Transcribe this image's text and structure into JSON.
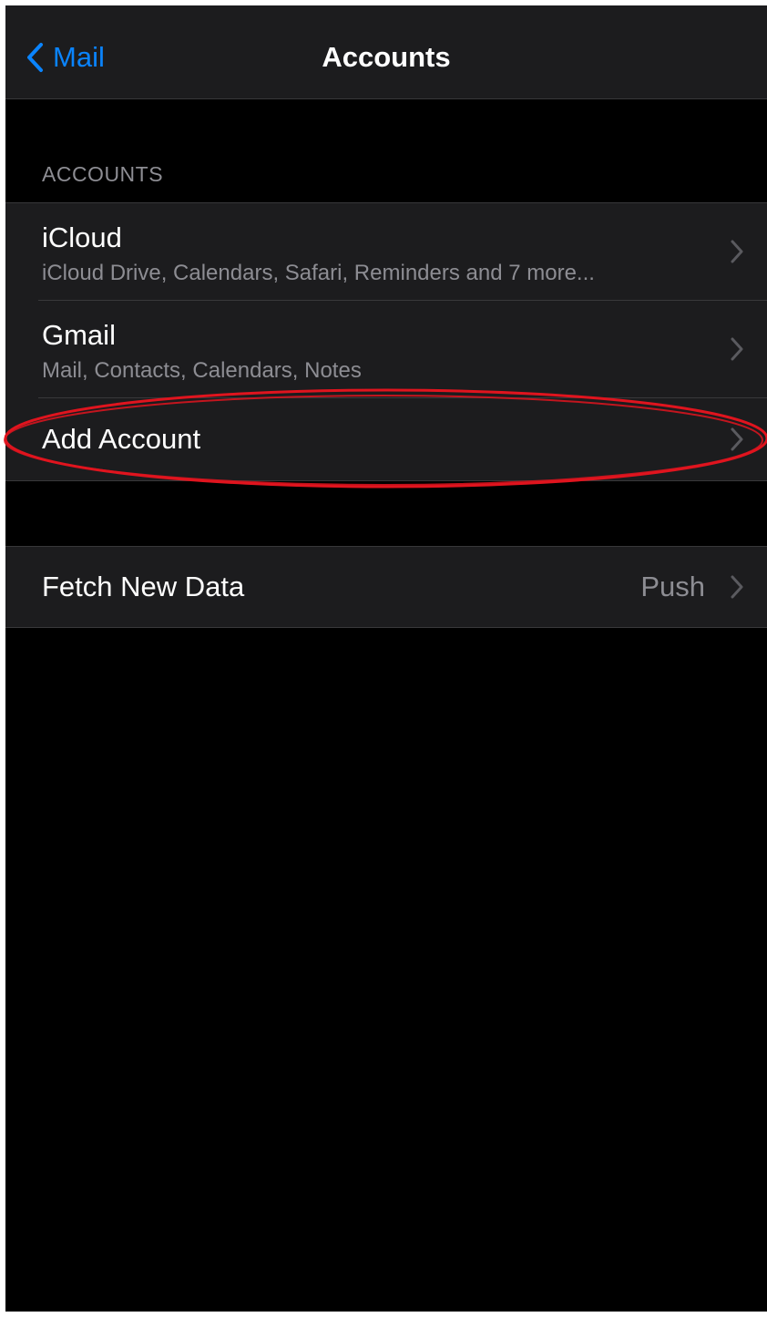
{
  "navbar": {
    "back_label": "Mail",
    "title": "Accounts"
  },
  "accounts_section": {
    "header": "ACCOUNTS",
    "items": [
      {
        "title": "iCloud",
        "subtitle": "iCloud Drive, Calendars, Safari, Reminders and 7 more..."
      },
      {
        "title": "Gmail",
        "subtitle": "Mail, Contacts, Calendars, Notes"
      }
    ],
    "add_account_label": "Add Account"
  },
  "fetch_section": {
    "label": "Fetch New Data",
    "value": "Push"
  },
  "colors": {
    "background": "#000000",
    "cell": "#1c1c1e",
    "accent": "#0a84ff",
    "secondary_text": "#8d8d93",
    "annotation": "#e0141e"
  },
  "icons": {
    "back": "chevron-left-icon",
    "disclosure": "chevron-right-icon"
  }
}
